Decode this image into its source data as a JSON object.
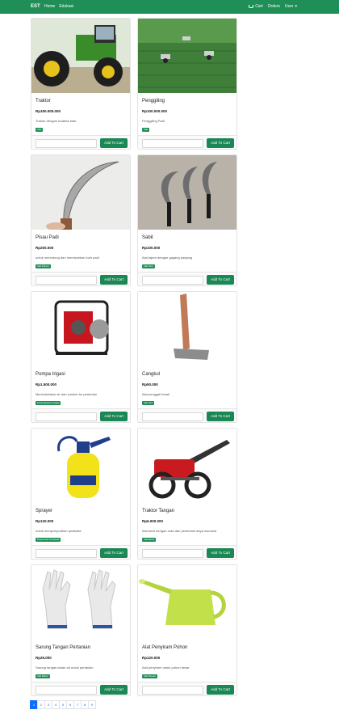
{
  "navbar": {
    "brand": "EST",
    "links": [
      "Home",
      "Edukasi"
    ],
    "cart": "Cart",
    "orders": "Orders",
    "user": "User"
  },
  "products": [
    {
      "name": "Traktor",
      "price": "Rp150.000.000",
      "description": "Traktor dengan kualitas baik",
      "category": "Alat",
      "button": "Add To Cart"
    },
    {
      "name": "Penggiling",
      "price": "Rp100.000.000",
      "description": "Penggiling Padi",
      "category": "Alat",
      "button": "Add To Cart"
    },
    {
      "name": "Pisau Padi",
      "price": "Rp200.000",
      "description": "untuk memotong dan memisahkan bulir padi",
      "category": "Alat Panen",
      "button": "Add To Cart"
    },
    {
      "name": "Sabit",
      "price": "Rp100.000",
      "description": "Alat tajam dengan gagang panjang",
      "category": "Alat Taní",
      "button": "Add To Cart"
    },
    {
      "name": "Pompa Irigasi",
      "price": "Rp1.500.000",
      "description": "Memindahkan air dari sumber ke pertanian",
      "category": "Perlengkapan Irigasi",
      "button": "Add To Cart"
    },
    {
      "name": "Cangkul",
      "price": "Rp50.000",
      "description": "Alat penggali tanah",
      "category": "Alat Tani",
      "button": "Add To Cart"
    },
    {
      "name": "Sprayer",
      "price": "Rp120.000",
      "description": "untuk menyemprotkan pestisida",
      "category": "Pupuk dan Pestisida",
      "button": "Add To Cart"
    },
    {
      "name": "Traktor Tangan",
      "price": "Rp6.000.000",
      "description": "Alat kecil dengan roda dan pemindah daya manusia",
      "category": "Alat Berat",
      "button": "Add To Cart"
    },
    {
      "name": "Sarung Tangan Pertanian",
      "price": "Rp25.000",
      "description": "Sarung tangan tahan air untuk pertanian",
      "category": "Alat Bantu",
      "button": "Add To Cart"
    },
    {
      "name": "Alat Penyiram Pohon",
      "price": "Rp120.000",
      "description": "Alat penyiram untuk pohon besar",
      "category": "Alat Taman",
      "button": "Add To Cart"
    }
  ],
  "pagination": {
    "pages": [
      "1",
      "2",
      "3",
      "4",
      "5",
      "6",
      "7",
      "8",
      "9"
    ],
    "current": "1"
  },
  "colors": {
    "brand": "#1f8f57",
    "button": "#1a8754",
    "pager_active": "#0d6efd"
  },
  "icons": [
    "cart-icon",
    "caret-down-icon"
  ]
}
